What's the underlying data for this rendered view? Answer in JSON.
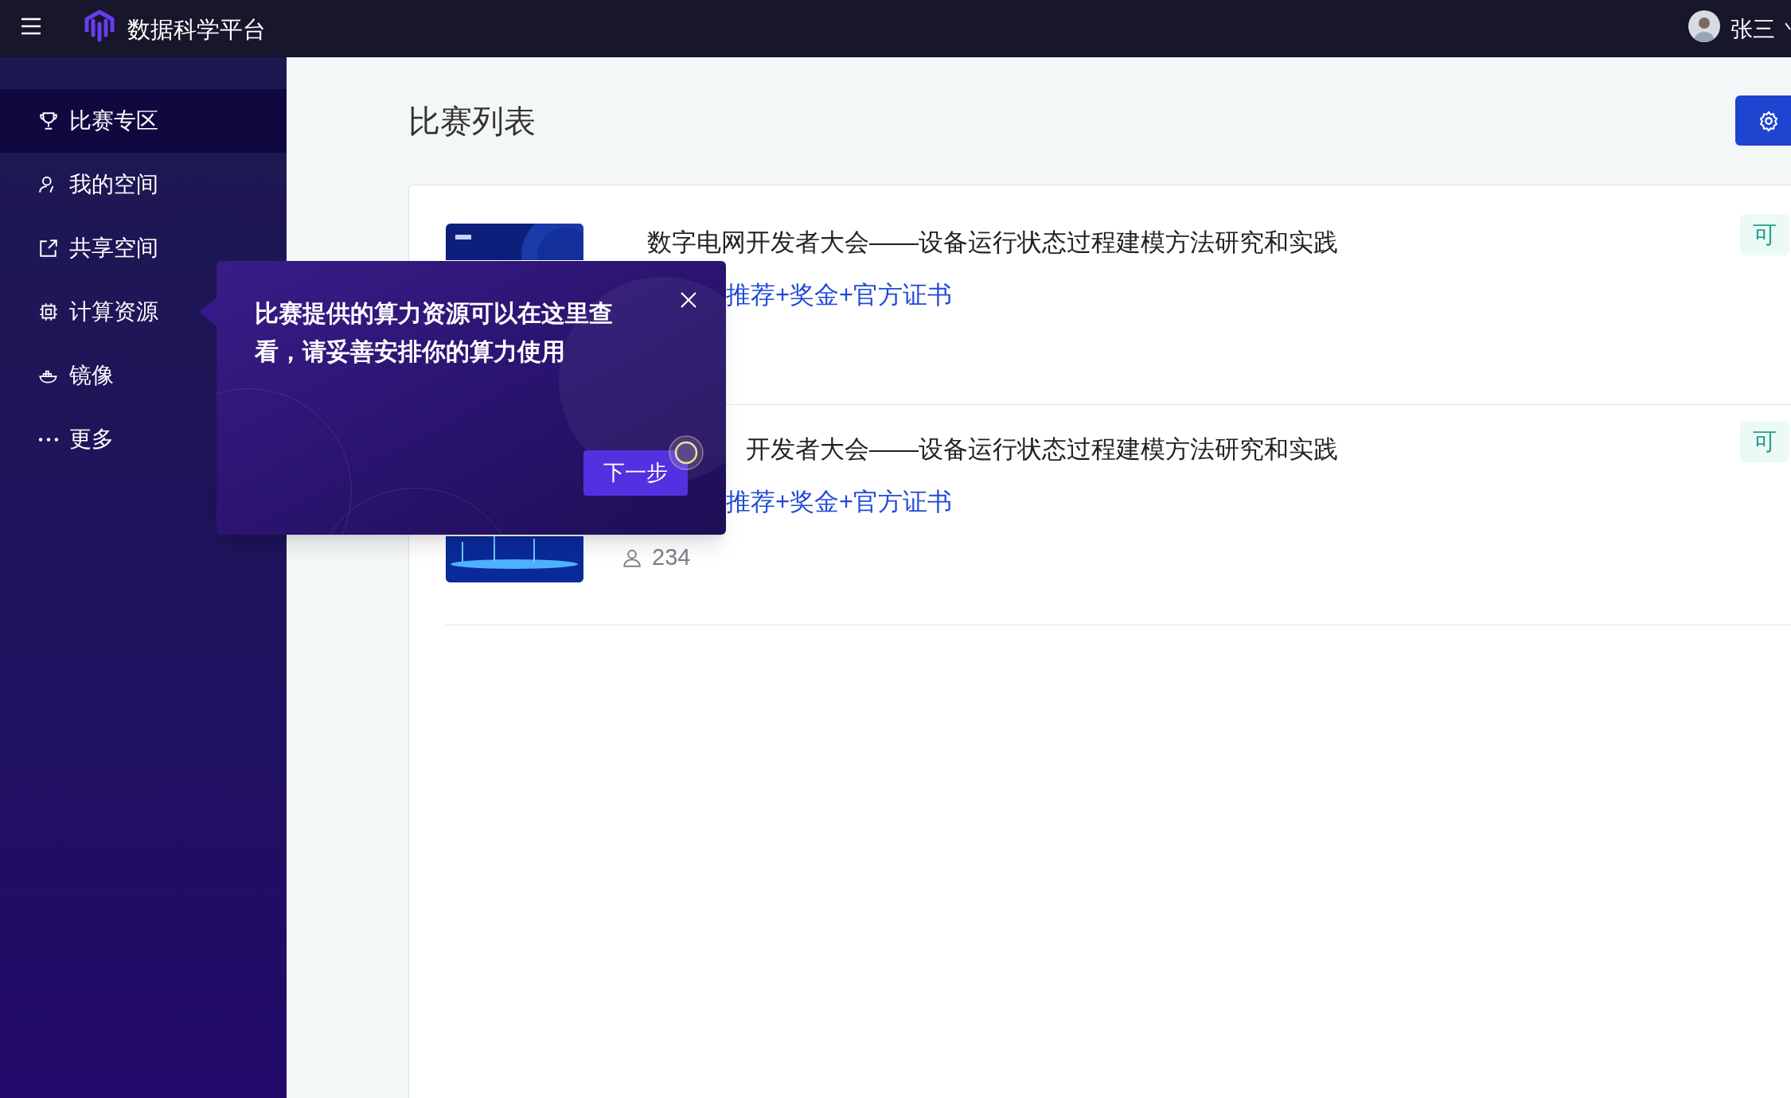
{
  "header": {
    "title": "数据科学平台",
    "user": "张三"
  },
  "sidebar": {
    "items": [
      {
        "label": "比赛专区",
        "selected": true
      },
      {
        "label": "我的空间",
        "selected": false
      },
      {
        "label": "共享空间",
        "selected": false
      },
      {
        "label": "计算资源",
        "selected": false
      },
      {
        "label": "镜像",
        "selected": false
      },
      {
        "label": "更多",
        "selected": false
      }
    ]
  },
  "page": {
    "title": "比赛列表"
  },
  "competitions": [
    {
      "title": "数字电网开发者大会——设备运行状态过程建模方法研究和实践",
      "tags": "推荐+奖金+官方证书",
      "status": "可"
    },
    {
      "title": "开发者大会——设备运行状态过程建模方法研究和实践",
      "tags": "推荐+奖金+官方证书",
      "participants": "234",
      "status": "可"
    }
  ],
  "tour": {
    "text": "比赛提供的算力资源可以在这里查看，请妥善安排你的算力使用",
    "next": "下一步"
  }
}
